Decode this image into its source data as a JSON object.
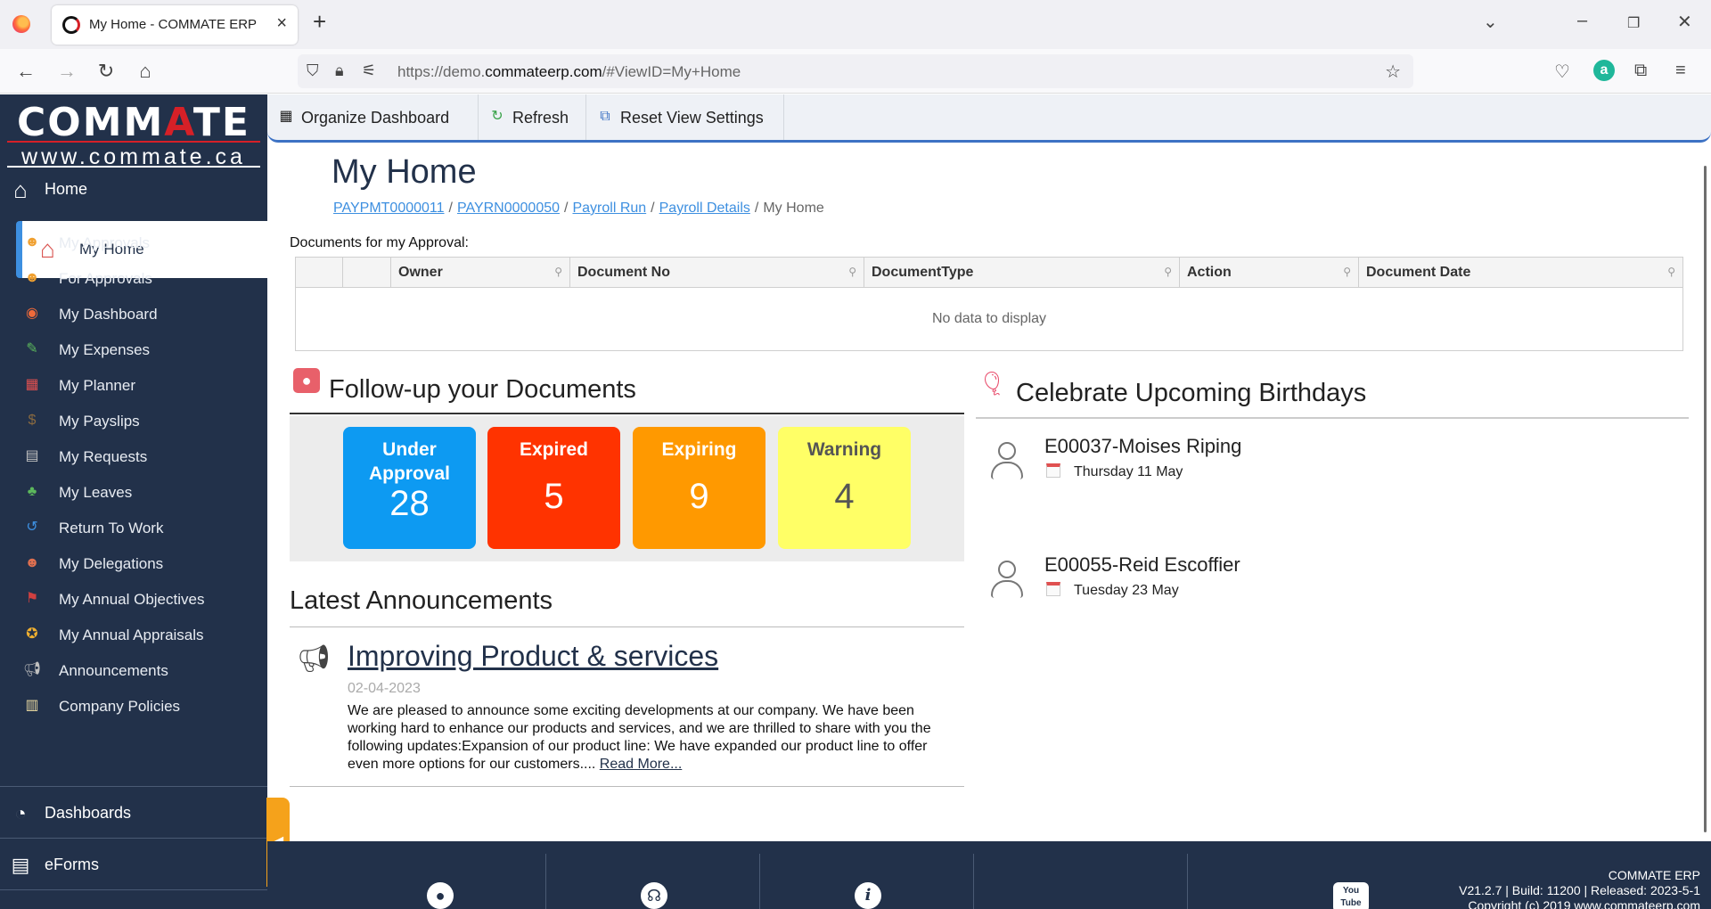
{
  "browser": {
    "tab_title": "My Home - COMMATE ERP",
    "url_prefix": "https://demo.",
    "url_domain": "commateerp.com",
    "url_suffix": "/#ViewID=My+Home"
  },
  "brand": {
    "name_part1": "COMM",
    "name_part2": "A",
    "name_part3": "TE",
    "url": "www.commate.ca"
  },
  "sidebar": {
    "home_label": "Home",
    "active_label": "My Home",
    "items": [
      {
        "label": "My Approvals",
        "icon": "approvals-icon",
        "color": "#f0a030"
      },
      {
        "label": "For Approvals",
        "icon": "for-approvals-icon",
        "color": "#f0a030"
      },
      {
        "label": "My Dashboard",
        "icon": "dashboard-icon",
        "color": "#f06a3a"
      },
      {
        "label": "My Expenses",
        "icon": "expenses-icon",
        "color": "#5cb85c"
      },
      {
        "label": "My Planner",
        "icon": "planner-icon",
        "color": "#e05050"
      },
      {
        "label": "My Payslips",
        "icon": "payslips-icon",
        "color": "#8a6a40"
      },
      {
        "label": "My Requests",
        "icon": "requests-icon",
        "color": "#c0c0c0"
      },
      {
        "label": "My Leaves",
        "icon": "leaves-icon",
        "color": "#5cb85c"
      },
      {
        "label": "Return To Work",
        "icon": "return-to-work-icon",
        "color": "#3d8fe0"
      },
      {
        "label": "My Delegations",
        "icon": "delegations-icon",
        "color": "#e07050"
      },
      {
        "label": "My Annual Objectives",
        "icon": "objectives-icon",
        "color": "#d04040"
      },
      {
        "label": "My Annual Appraisals",
        "icon": "appraisals-icon",
        "color": "#f0b030"
      },
      {
        "label": "Announcements",
        "icon": "announcements-icon",
        "color": "#c0c0c0"
      },
      {
        "label": "Company Policies",
        "icon": "policies-icon",
        "color": "#e8d8a0"
      }
    ],
    "dashboards_label": "Dashboards",
    "eforms_label": "eForms"
  },
  "toolbar": {
    "organize_label": "Organize Dashboard",
    "refresh_label": "Refresh",
    "reset_label": "Reset View Settings"
  },
  "page": {
    "title": "My Home",
    "breadcrumbs": [
      "PAYPMT0000011",
      "PAYRN0000050",
      "Payroll Run",
      "Payroll Details"
    ],
    "breadcrumb_current": "My Home"
  },
  "approvals": {
    "label": "Documents for my Approval:",
    "columns": [
      "Owner",
      "Document No",
      "DocumentType",
      "Action",
      "Document Date"
    ],
    "empty_text": "No data to display"
  },
  "followup": {
    "title": "Follow-up your Documents",
    "tiles": [
      {
        "label": "Under Approval",
        "value": "28",
        "color": "#0d9af2"
      },
      {
        "label": "Expired",
        "value": "5",
        "color": "#ff3300"
      },
      {
        "label": "Expiring",
        "value": "9",
        "color": "#ff9900"
      },
      {
        "label": "Warning",
        "value": "4",
        "color": "#ffff66"
      }
    ]
  },
  "announcements": {
    "title": "Latest Announcements",
    "headline": "Improving Product & services",
    "date": "02-04-2023",
    "body": "We are pleased to announce some exciting developments at our company. We have been working hard to enhance our products and services, and we are thrilled to share with you the following updates:Expansion of our product line: We have expanded our product line to offer even more options for our customers.... ",
    "read_more": "Read More..."
  },
  "birthdays": {
    "title": "Celebrate Upcoming Birthdays",
    "items": [
      {
        "name": "E00037-Moises Riping",
        "date": "Thursday 11 May"
      },
      {
        "name": "E00055-Reid Escoffier",
        "date": "Tuesday 23 May"
      }
    ]
  },
  "footer": {
    "app": "COMMATE ERP",
    "version": "V21.2.7 | Build: 11200 | Released: 2023-5-1",
    "copyright": "Copyright (c) 2019 www.commateerp.com"
  }
}
